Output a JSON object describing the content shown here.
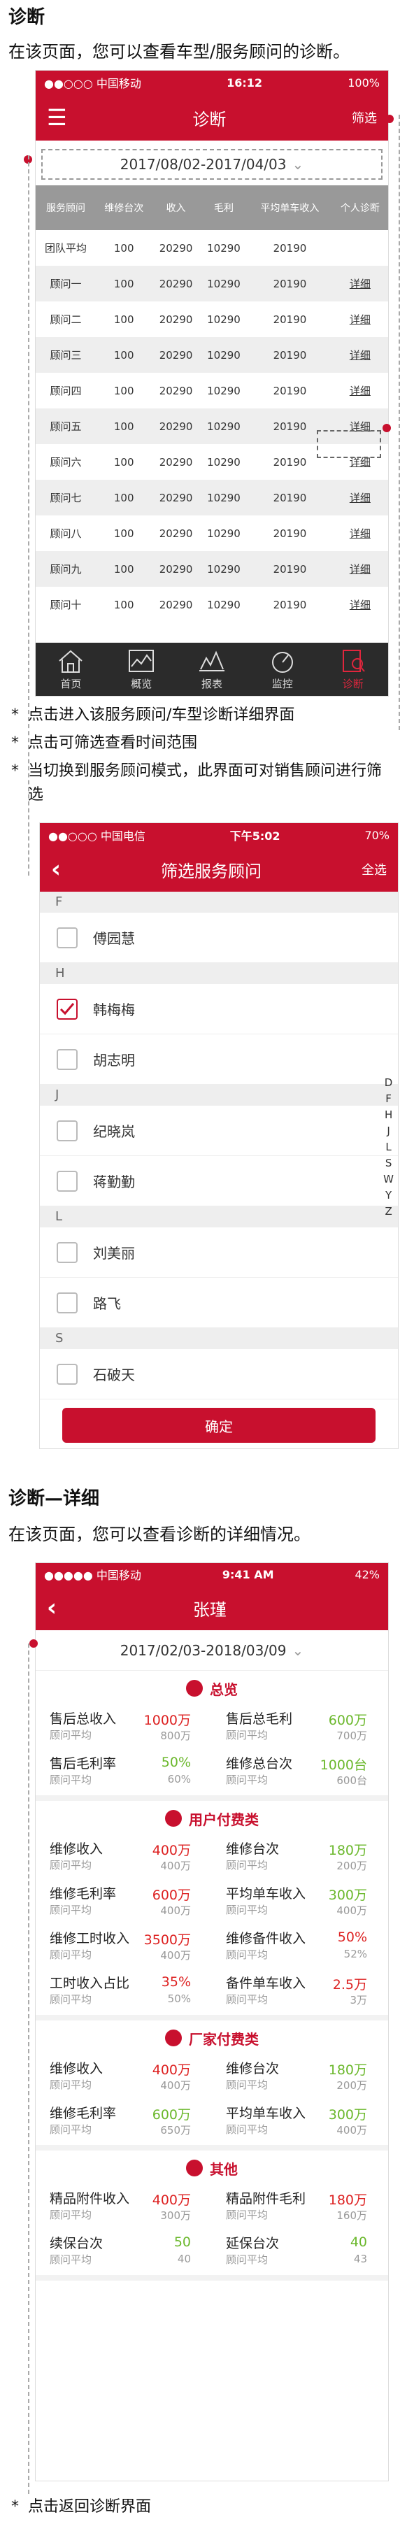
{
  "sec1": {
    "title": "诊断",
    "desc": "在该页面，您可以查看车型/服务顾问的诊断。"
  },
  "phone1": {
    "status": {
      "carrier": "●●○○○ 中国移动",
      "time": "16:12",
      "battery": "100%"
    },
    "nav": {
      "title": "诊断",
      "filter": "筛选"
    },
    "date_range": "2017/08/02-2017/04/03",
    "table": {
      "headers": [
        "服务顾问",
        "维修台次",
        "收入",
        "毛利",
        "平均单车收入",
        "个人诊断"
      ],
      "rows": [
        [
          "团队平均",
          "100",
          "20290",
          "10290",
          "20190",
          ""
        ],
        [
          "顾问一",
          "100",
          "20290",
          "10290",
          "20190",
          "详细"
        ],
        [
          "顾问二",
          "100",
          "20290",
          "10290",
          "20190",
          "详细"
        ],
        [
          "顾问三",
          "100",
          "20290",
          "10290",
          "20190",
          "详细"
        ],
        [
          "顾问四",
          "100",
          "20290",
          "10290",
          "20190",
          "详细"
        ],
        [
          "顾问五",
          "100",
          "20290",
          "10290",
          "20190",
          "详细"
        ],
        [
          "顾问六",
          "100",
          "20290",
          "10290",
          "20190",
          "详细"
        ],
        [
          "顾问七",
          "100",
          "20290",
          "10290",
          "20190",
          "详细"
        ],
        [
          "顾问八",
          "100",
          "20290",
          "10290",
          "20190",
          "详细"
        ],
        [
          "顾问九",
          "100",
          "20290",
          "10290",
          "20190",
          "详细"
        ],
        [
          "顾问十",
          "100",
          "20290",
          "10290",
          "20190",
          "详细"
        ]
      ]
    },
    "tabs": [
      "首页",
      "概览",
      "报表",
      "监控",
      "诊断"
    ]
  },
  "notes1": [
    "点击进入该服务顾问/车型诊断详细界面",
    "点击可筛选查看时间范围",
    "当切换到服务顾问模式，此界面可对销售顾问进行筛选"
  ],
  "phone2": {
    "status": {
      "carrier": "●●○○○ 中国电信",
      "time": "下午5:02",
      "battery": "70%"
    },
    "nav": {
      "title": "筛选服务顾问",
      "right": "全选"
    },
    "groups": [
      {
        "letter": "F",
        "names": [
          "傅园慧"
        ]
      },
      {
        "letter": "H",
        "names": [
          "韩梅梅",
          "胡志明"
        ]
      },
      {
        "letter": "J",
        "names": [
          "纪晓岚",
          "蒋勤勤"
        ]
      },
      {
        "letter": "L",
        "names": [
          "刘美丽",
          "路飞"
        ]
      },
      {
        "letter": "S",
        "names": [
          "石破天"
        ]
      }
    ],
    "alpha": [
      "D",
      "F",
      "H",
      "J",
      "L",
      "S",
      "W",
      "Y",
      "Z"
    ],
    "confirm": "确定"
  },
  "sec2": {
    "title": "诊断—详细",
    "desc": "在该页面，您可以查看诊断的详细情况。"
  },
  "phone3": {
    "status": {
      "carrier": "●●●●● 中国移动",
      "time": "9:41 AM",
      "battery": "42%"
    },
    "nav": {
      "title": "张瑾"
    },
    "date_range": "2017/02/03-2018/03/09",
    "groups": [
      {
        "title": "总览",
        "metrics": [
          {
            "name": "售后总收入",
            "sub": "顾问平均",
            "val": "1000万",
            "val2": "800万",
            "color": "#d22"
          },
          {
            "name": "售后总毛利",
            "sub": "顾问平均",
            "val": "600万",
            "val2": "700万",
            "color": "#6bb82c"
          },
          {
            "name": "售后毛利率",
            "sub": "顾问平均",
            "val": "50%",
            "val2": "60%",
            "color": "#6bb82c"
          },
          {
            "name": "维修总台次",
            "sub": "顾问平均",
            "val": "1000台",
            "val2": "600台",
            "color": "#6bb82c"
          }
        ]
      },
      {
        "title": "用户付费类",
        "metrics": [
          {
            "name": "维修收入",
            "sub": "顾问平均",
            "val": "400万",
            "val2": "400万",
            "color": "#d22"
          },
          {
            "name": "维修台次",
            "sub": "顾问平均",
            "val": "180万",
            "val2": "200万",
            "color": "#6bb82c"
          },
          {
            "name": "维修毛利率",
            "sub": "顾问平均",
            "val": "600万",
            "val2": "400万",
            "color": "#d22"
          },
          {
            "name": "平均单车收入",
            "sub": "顾问平均",
            "val": "300万",
            "val2": "400万",
            "color": "#6bb82c"
          },
          {
            "name": "维修工时收入",
            "sub": "顾问平均",
            "val": "3500万",
            "val2": "400万",
            "color": "#d22"
          },
          {
            "name": "维修备件收入",
            "sub": "顾问平均",
            "val": "50%",
            "val2": "52%",
            "color": "#d22"
          },
          {
            "name": "工时收入占比",
            "sub": "顾问平均",
            "val": "35%",
            "val2": "50%",
            "color": "#d22"
          },
          {
            "name": "备件单车收入",
            "sub": "顾问平均",
            "val": "2.5万",
            "val2": "3万",
            "color": "#d22"
          }
        ]
      },
      {
        "title": "厂家付费类",
        "metrics": [
          {
            "name": "维修收入",
            "sub": "顾问平均",
            "val": "400万",
            "val2": "400万",
            "color": "#d22"
          },
          {
            "name": "维修台次",
            "sub": "顾问平均",
            "val": "180万",
            "val2": "200万",
            "color": "#6bb82c"
          },
          {
            "name": "维修毛利率",
            "sub": "顾问平均",
            "val": "600万",
            "val2": "650万",
            "color": "#6bb82c"
          },
          {
            "name": "平均单车收入",
            "sub": "顾问平均",
            "val": "300万",
            "val2": "400万",
            "color": "#6bb82c"
          }
        ]
      },
      {
        "title": "其他",
        "metrics": [
          {
            "name": "精品附件收入",
            "sub": "顾问平均",
            "val": "400万",
            "val2": "300万",
            "color": "#d22"
          },
          {
            "name": "精品附件毛利",
            "sub": "顾问平均",
            "val": "180万",
            "val2": "160万",
            "color": "#d22"
          },
          {
            "name": "续保台次",
            "sub": "顾问平均",
            "val": "50",
            "val2": "40",
            "color": "#6bb82c"
          },
          {
            "name": "延保台次",
            "sub": "顾问平均",
            "val": "40",
            "val2": "43",
            "color": "#6bb82c"
          }
        ]
      }
    ]
  },
  "notes2": [
    "点击返回诊断界面"
  ]
}
